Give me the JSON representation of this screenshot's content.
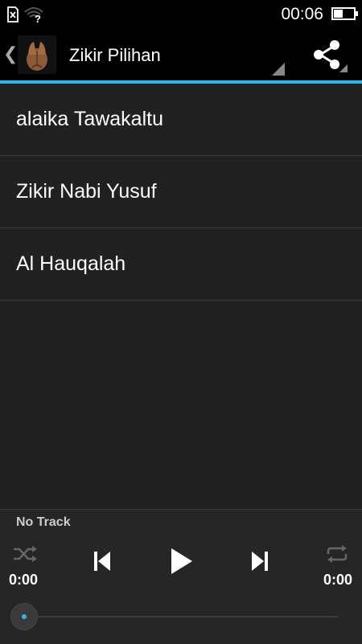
{
  "status_bar": {
    "time": "00:06",
    "battery_level": 0.45,
    "icons": [
      "sim-x-icon",
      "wifi-question-icon"
    ]
  },
  "action_bar": {
    "title": "Zikir Pilihan",
    "accent_color": "#33b5e5"
  },
  "list": {
    "items": [
      {
        "label": "alaika Tawakaltu"
      },
      {
        "label": "Zikir Nabi Yusuf"
      },
      {
        "label": "Al Hauqalah"
      }
    ]
  },
  "player": {
    "track_name": "No Track",
    "elapsed": "0:00",
    "duration": "0:00",
    "progress": 0
  }
}
